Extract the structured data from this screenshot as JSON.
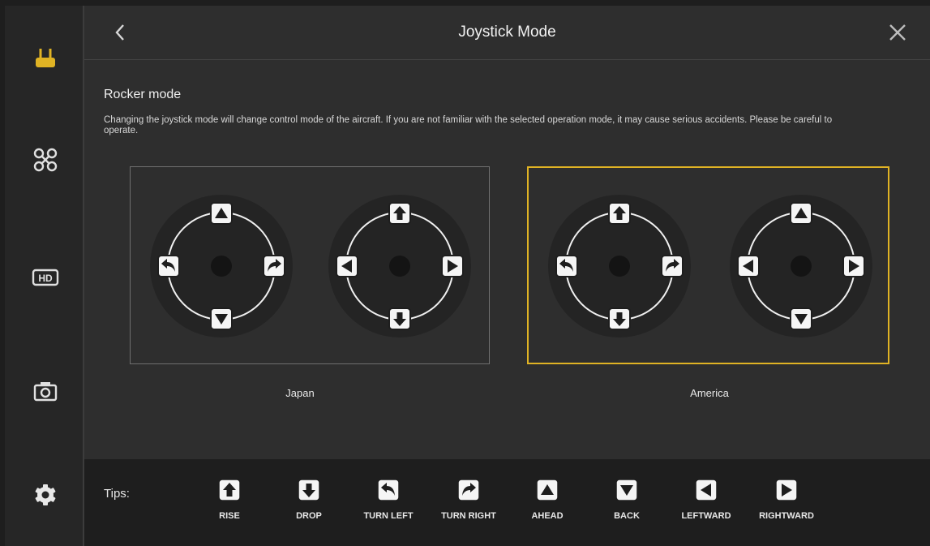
{
  "header": {
    "title": "Joystick Mode"
  },
  "sidebar": {
    "items": [
      {
        "icon": "remote-controller-icon",
        "active": true
      },
      {
        "icon": "drone-icon",
        "active": false
      },
      {
        "icon": "hd-transmission-icon",
        "active": false,
        "text": "HD"
      },
      {
        "icon": "camera-icon",
        "active": false
      },
      {
        "icon": "gear-icon",
        "active": false
      }
    ]
  },
  "section": {
    "title": "Rocker mode",
    "warning": "Changing the joystick mode will change control mode of the aircraft. If you are not familiar with the selected operation mode, it may cause serious accidents. Please be careful to operate."
  },
  "modes": [
    {
      "label": "Japan",
      "selected": false,
      "left_stick": {
        "up": "ahead-icon",
        "down": "back-icon",
        "left": "turn-left-icon",
        "right": "turn-right-icon"
      },
      "right_stick": {
        "up": "rise-icon",
        "down": "drop-icon",
        "left": "leftward-icon",
        "right": "rightward-icon"
      }
    },
    {
      "label": "America",
      "selected": true,
      "left_stick": {
        "up": "rise-icon",
        "down": "drop-icon",
        "left": "turn-left-icon",
        "right": "turn-right-icon"
      },
      "right_stick": {
        "up": "ahead-icon",
        "down": "back-icon",
        "left": "leftward-icon",
        "right": "rightward-icon"
      }
    }
  ],
  "tips": {
    "label": "Tips:",
    "items": [
      {
        "icon": "rise-icon",
        "label": "RISE"
      },
      {
        "icon": "drop-icon",
        "label": "DROP"
      },
      {
        "icon": "turn-left-icon",
        "label": "TURN LEFT"
      },
      {
        "icon": "turn-right-icon",
        "label": "TURN RIGHT"
      },
      {
        "icon": "ahead-icon",
        "label": "AHEAD"
      },
      {
        "icon": "back-icon",
        "label": "BACK"
      },
      {
        "icon": "leftward-icon",
        "label": "LEFTWARD"
      },
      {
        "icon": "rightward-icon",
        "label": "RIGHTWARD"
      }
    ]
  },
  "colors": {
    "accent": "#e0b324",
    "background": "#2e2e2e",
    "sidebar": "#262626",
    "tips_bar": "#1e1e1e"
  }
}
